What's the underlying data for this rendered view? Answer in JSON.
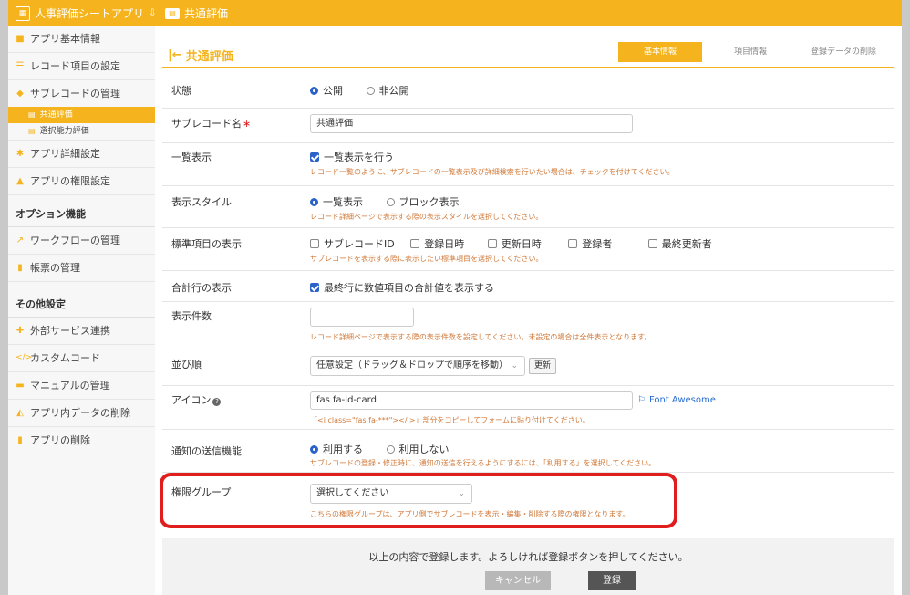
{
  "app": {
    "title": "人事評価シートアプリ",
    "breadcrumb": "共通評価"
  },
  "sidebar": {
    "items": [
      {
        "label": "アプリ基本情報",
        "icon": "info-icon",
        "color": "#f5b41e"
      },
      {
        "label": "レコード項目の設定",
        "icon": "list-icon",
        "color": "#f5b41e"
      },
      {
        "label": "サブレコードの管理",
        "icon": "subrecord-icon",
        "color": "#f5b41e"
      }
    ],
    "sub_items": [
      {
        "label": "共通評価",
        "active": true
      },
      {
        "label": "選択能力評価",
        "active": false
      }
    ],
    "items2": [
      {
        "label": "アプリ詳細設定",
        "icon": "gear-icon"
      },
      {
        "label": "アプリの権限設定",
        "icon": "users-icon"
      }
    ],
    "section_options": "オプション機能",
    "options": [
      {
        "label": "ワークフローの管理",
        "icon": "workflow-icon"
      },
      {
        "label": "帳票の管理",
        "icon": "document-icon"
      }
    ],
    "section_other": "その他設定",
    "other": [
      {
        "label": "外部サービス連携",
        "icon": "puzzle-icon"
      },
      {
        "label": "カスタムコード",
        "icon": "code-icon"
      },
      {
        "label": "マニュアルの管理",
        "icon": "book-icon"
      },
      {
        "label": "アプリ内データの削除",
        "icon": "data-delete-icon"
      },
      {
        "label": "アプリの削除",
        "icon": "trash-icon"
      }
    ]
  },
  "main": {
    "title": "共通評価",
    "tabs": [
      {
        "label": "基本情報",
        "active": true
      },
      {
        "label": "項目情報",
        "active": false
      },
      {
        "label": "登録データの削除",
        "active": false
      }
    ],
    "rows": {
      "status": {
        "label": "状態",
        "options": [
          "公開",
          "非公開"
        ],
        "selected": "公開"
      },
      "name": {
        "label": "サブレコード名",
        "value": "共通評価"
      },
      "list_display": {
        "label": "一覧表示",
        "checkbox": "一覧表示を行う",
        "checked": true,
        "hint": "レコード一覧のように、サブレコードの一覧表示及び詳細検索を行いたい場合は、チェックを付けてください。"
      },
      "display_style": {
        "label": "表示スタイル",
        "options": [
          "一覧表示",
          "ブロック表示"
        ],
        "selected": "一覧表示",
        "hint": "レコード詳細ページで表示する際の表示スタイルを選択してください。"
      },
      "standard_fields": {
        "label": "標準項目の表示",
        "options": [
          "サブレコードID",
          "登録日時",
          "更新日時",
          "登録者",
          "最終更新者"
        ],
        "hint": "サブレコードを表示する際に表示したい標準項目を選択してください。"
      },
      "total_row": {
        "label": "合計行の表示",
        "checkbox": "最終行に数値項目の合計値を表示する",
        "checked": true
      },
      "display_count": {
        "label": "表示件数",
        "value": "",
        "hint": "レコード詳細ページで表示する際の表示件数を設定してください。未設定の場合は全件表示となります。"
      },
      "sort": {
        "label": "並び順",
        "value": "任意設定（ドラッグ＆ドロップで順序を移動）",
        "button": "更新"
      },
      "icon": {
        "label": "アイコン",
        "value": "fas fa-id-card",
        "link": "Font Awesome",
        "hint": "「<i class=\"fas fa-***\"></i>」部分をコピーしてフォームに貼り付けてください。"
      },
      "notification": {
        "label": "通知の送信機能",
        "options": [
          "利用する",
          "利用しない"
        ],
        "selected": "利用する",
        "hint": "サブレコードの登録・修正時に、通知の送信を行えるようにするには、「利用する」を選択してください。"
      },
      "permission_group": {
        "label": "権限グループ",
        "value": "選択してください",
        "hint": "こちらの権限グループは、アプリ側でサブレコードを表示・編集・削除する際の権限となります。"
      }
    },
    "footer": {
      "message": "以上の内容で登録します。よろしければ登録ボタンを押してください。",
      "cancel": "キャンセル",
      "submit": "登録"
    }
  },
  "colors": {
    "accent": "#f5b41e",
    "highlight": "#e01e1e",
    "link": "#2a6fd0",
    "hint": "#d07a3a"
  }
}
